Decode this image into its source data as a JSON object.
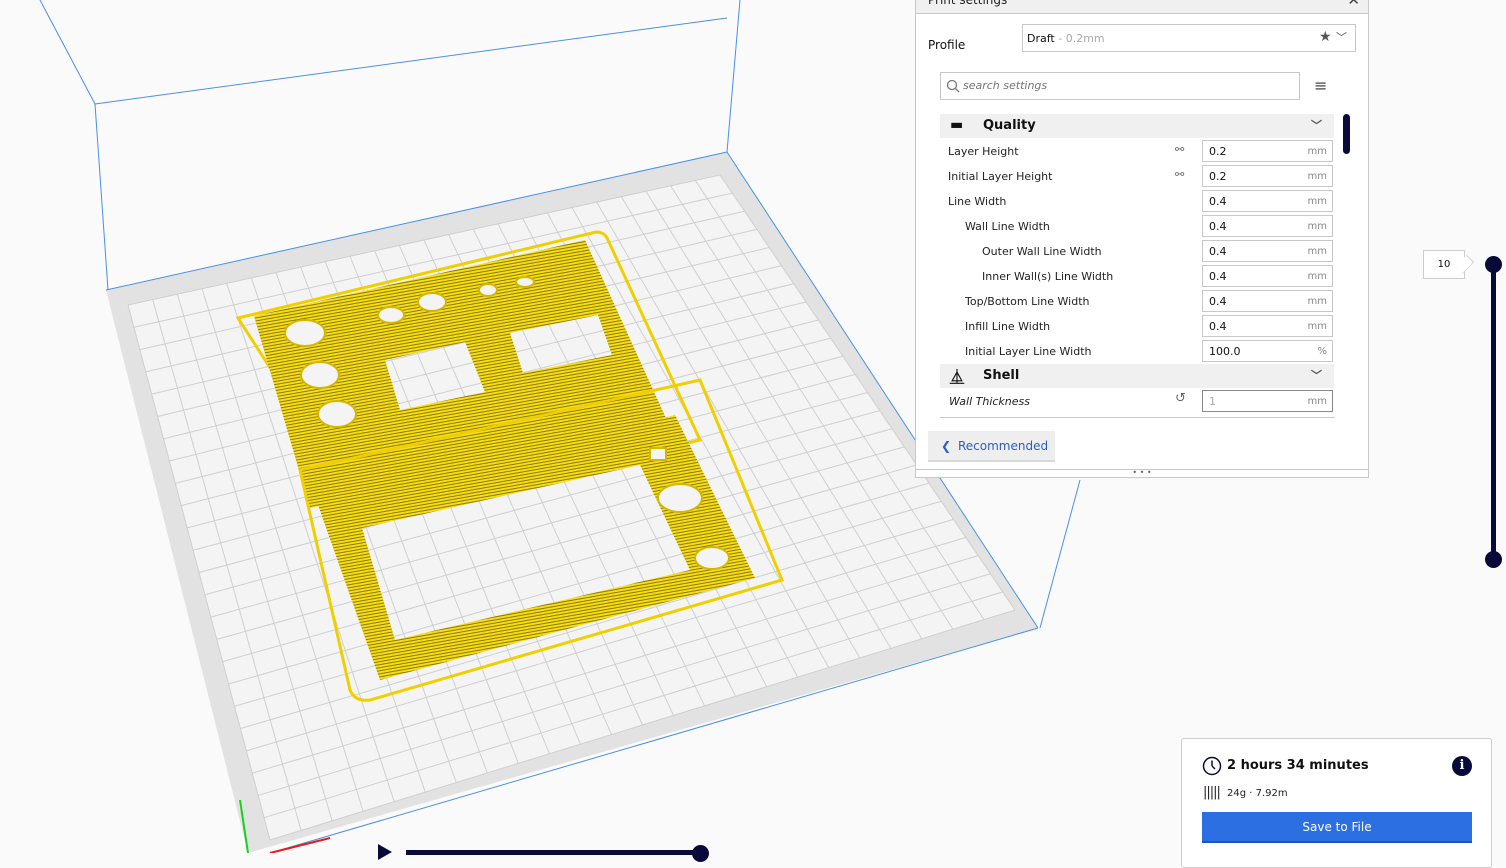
{
  "panel": {
    "title": "Print settings",
    "close_icon": "close-icon",
    "profile_label": "Profile",
    "profile_name": "Draft",
    "profile_sub": " - 0.2mm",
    "search_placeholder": "search settings",
    "recommended_label": "Recommended",
    "handle_glyph": "• • •"
  },
  "categories": [
    {
      "label": "Quality",
      "icon": "quality-icon"
    },
    {
      "label": "Shell",
      "icon": "shell-icon"
    }
  ],
  "quality_settings": [
    {
      "label": "Layer Height",
      "value": "0.2",
      "unit": "mm",
      "linked": true,
      "indent": 0
    },
    {
      "label": "Initial Layer Height",
      "value": "0.2",
      "unit": "mm",
      "linked": true,
      "indent": 0
    },
    {
      "label": "Line Width",
      "value": "0.4",
      "unit": "mm",
      "indent": 0
    },
    {
      "label": "Wall Line Width",
      "value": "0.4",
      "unit": "mm",
      "indent": 1
    },
    {
      "label": "Outer Wall Line Width",
      "value": "0.4",
      "unit": "mm",
      "indent": 2
    },
    {
      "label": "Inner Wall(s) Line Width",
      "value": "0.4",
      "unit": "mm",
      "indent": 2
    },
    {
      "label": "Top/Bottom Line Width",
      "value": "0.4",
      "unit": "mm",
      "indent": 1
    },
    {
      "label": "Infill Line Width",
      "value": "0.4",
      "unit": "mm",
      "indent": 1
    },
    {
      "label": "Initial Layer Line Width",
      "value": "100.0",
      "unit": "%",
      "indent": 1
    }
  ],
  "shell_settings": [
    {
      "label": "Wall Thickness",
      "value": "1",
      "unit": "mm",
      "reset": true
    }
  ],
  "layer_view": {
    "current_layer": "10"
  },
  "summary": {
    "print_time": "2 hours 34 minutes",
    "material": "24g · 7.92m",
    "save_label": "Save to File",
    "info_glyph": "i"
  },
  "colors": {
    "accent": "#2b6fe3",
    "dark": "#0a0a3a",
    "filament": "#f5d90a",
    "build_edge": "#4a8fe8"
  }
}
